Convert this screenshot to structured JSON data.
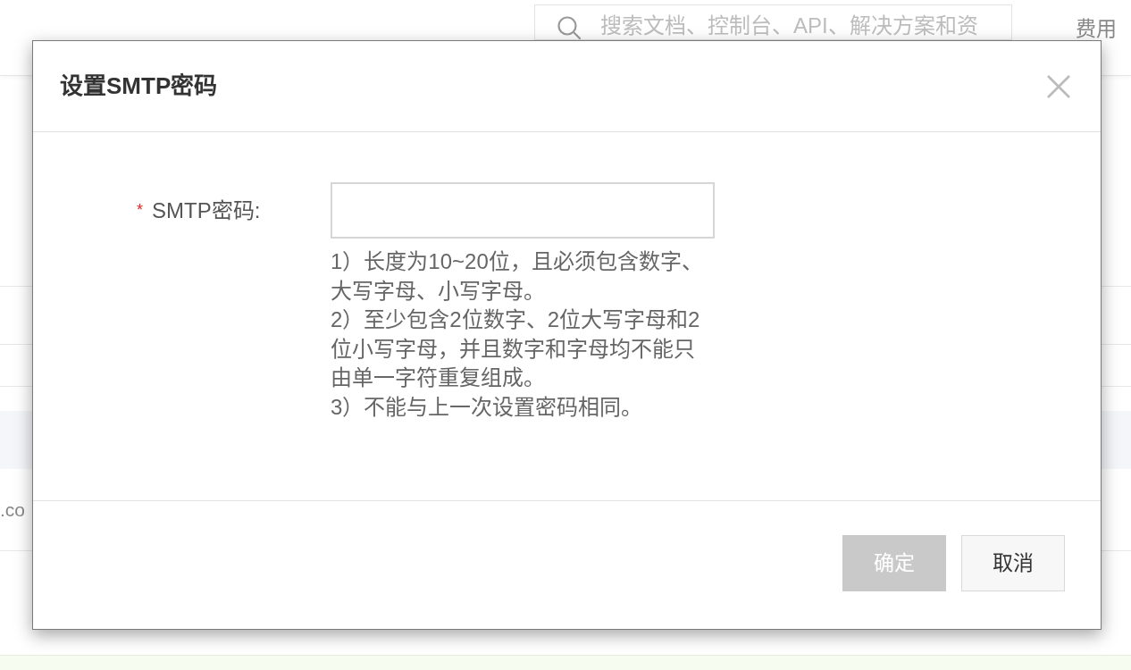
{
  "page": {
    "search": {
      "placeholder": "搜索文档、控制台、API、解决方案和资"
    },
    "header_link": "费用",
    "row_text": ".co"
  },
  "dialog": {
    "title": "设置SMTP密码",
    "field": {
      "label": "SMTP密码:",
      "required": true,
      "required_mark": "*"
    },
    "hints": [
      "1）长度为10~20位，且必须包含数字、大写字母、小写字母。",
      "2）至少包含2位数字、2位大写字母和2位小写字母，并且数字和字母均不能只由单一字符重复组成。",
      "3）不能与上一次设置密码相同。"
    ],
    "buttons": [
      {
        "label": "确定",
        "kind": "primary",
        "disabled": true
      },
      {
        "label": "取消",
        "kind": "default",
        "disabled": false
      }
    ]
  }
}
